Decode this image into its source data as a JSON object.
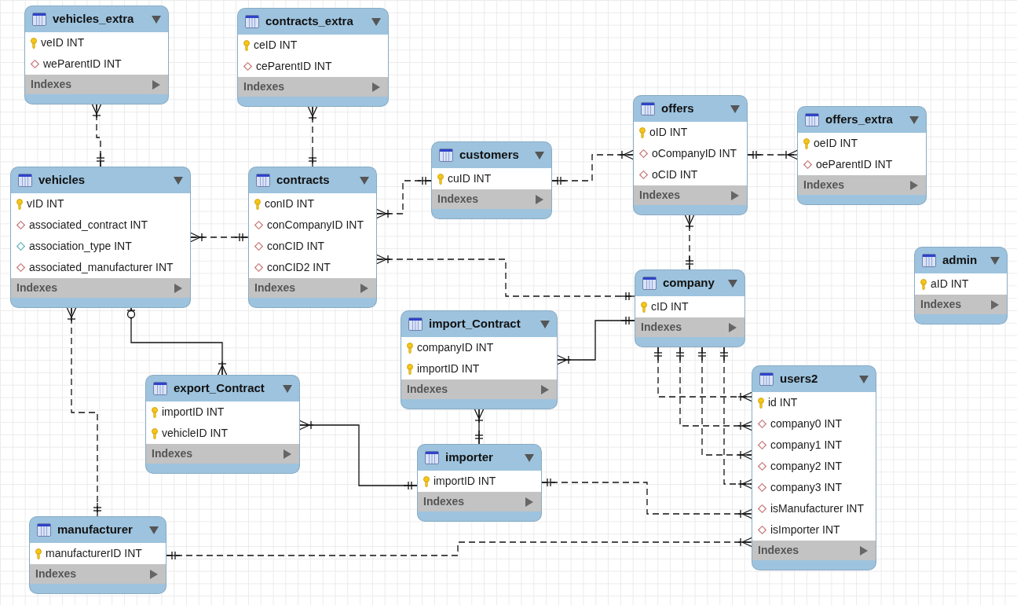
{
  "tables": [
    {
      "name": "vehicles_extra",
      "fields": [
        {
          "label": "veID INT",
          "kind": "primary_key"
        },
        {
          "label": "weParentID INT",
          "kind": "foreign_key"
        }
      ],
      "indexes": "Indexes"
    },
    {
      "name": "contracts_extra",
      "fields": [
        {
          "label": "ceID INT",
          "kind": "primary_key"
        },
        {
          "label": "ceParentID INT",
          "kind": "foreign_key"
        }
      ],
      "indexes": "Indexes"
    },
    {
      "name": "offers",
      "fields": [
        {
          "label": "oID INT",
          "kind": "primary_key"
        },
        {
          "label": "oCompanyID INT",
          "kind": "foreign_key"
        },
        {
          "label": "oCID INT",
          "kind": "foreign_key"
        }
      ],
      "indexes": "Indexes"
    },
    {
      "name": "offers_extra",
      "fields": [
        {
          "label": "oeID INT",
          "kind": "primary_key"
        },
        {
          "label": "oeParentID INT",
          "kind": "foreign_key"
        }
      ],
      "indexes": "Indexes"
    },
    {
      "name": "customers",
      "fields": [
        {
          "label": "cuID INT",
          "kind": "primary_key"
        }
      ],
      "indexes": "Indexes"
    },
    {
      "name": "vehicles",
      "fields": [
        {
          "label": "vID INT",
          "kind": "primary_key"
        },
        {
          "label": "associated_contract INT",
          "kind": "foreign_key"
        },
        {
          "label": "association_type INT",
          "kind": "column"
        },
        {
          "label": "associated_manufacturer INT",
          "kind": "foreign_key"
        }
      ],
      "indexes": "Indexes"
    },
    {
      "name": "contracts",
      "fields": [
        {
          "label": "conID INT",
          "kind": "primary_key"
        },
        {
          "label": "conCompanyID INT",
          "kind": "foreign_key"
        },
        {
          "label": "conCID INT",
          "kind": "foreign_key"
        },
        {
          "label": "conCID2 INT",
          "kind": "foreign_key"
        }
      ],
      "indexes": "Indexes"
    },
    {
      "name": "admin",
      "fields": [
        {
          "label": "aID INT",
          "kind": "primary_key"
        }
      ],
      "indexes": "Indexes"
    },
    {
      "name": "company",
      "fields": [
        {
          "label": "cID INT",
          "kind": "primary_key"
        }
      ],
      "indexes": "Indexes"
    },
    {
      "name": "import_Contract",
      "fields": [
        {
          "label": "companyID INT",
          "kind": "primary_key"
        },
        {
          "label": "importID INT",
          "kind": "primary_key"
        }
      ],
      "indexes": "Indexes"
    },
    {
      "name": "users2",
      "fields": [
        {
          "label": "id INT",
          "kind": "primary_key"
        },
        {
          "label": "company0 INT",
          "kind": "foreign_key"
        },
        {
          "label": "company1 INT",
          "kind": "foreign_key"
        },
        {
          "label": "company2 INT",
          "kind": "foreign_key"
        },
        {
          "label": "company3 INT",
          "kind": "foreign_key"
        },
        {
          "label": "isManufacturer INT",
          "kind": "foreign_key"
        },
        {
          "label": "isImporter INT",
          "kind": "foreign_key"
        }
      ],
      "indexes": "Indexes"
    },
    {
      "name": "export_Contract",
      "fields": [
        {
          "label": "importID INT",
          "kind": "primary_key"
        },
        {
          "label": "vehicleID INT",
          "kind": "primary_key"
        }
      ],
      "indexes": "Indexes"
    },
    {
      "name": "importer",
      "fields": [
        {
          "label": "importID INT",
          "kind": "primary_key"
        }
      ],
      "indexes": "Indexes"
    },
    {
      "name": "manufacturer",
      "fields": [
        {
          "label": "manufacturerID INT",
          "kind": "primary_key"
        }
      ],
      "indexes": "Indexes"
    }
  ],
  "relationships": [
    {
      "identifying": false,
      "start": {
        "many": true,
        "optional": false
      },
      "end": {
        "many": false,
        "optional": false
      }
    },
    {
      "identifying": false,
      "start": {
        "many": true,
        "optional": false
      },
      "end": {
        "many": false,
        "optional": false
      }
    },
    {
      "identifying": false,
      "start": {
        "many": true,
        "optional": false
      },
      "end": {
        "many": false,
        "optional": false
      }
    },
    {
      "identifying": false,
      "start": {
        "many": true,
        "optional": false
      },
      "end": {
        "many": false,
        "optional": false
      }
    },
    {
      "identifying": false,
      "start": {
        "many": false,
        "optional": false
      },
      "end": {
        "many": true,
        "optional": false
      }
    },
    {
      "identifying": false,
      "start": {
        "many": false,
        "optional": false
      },
      "end": {
        "many": true,
        "optional": false
      }
    },
    {
      "identifying": false,
      "start": {
        "many": true,
        "optional": false
      },
      "end": {
        "many": false,
        "optional": false
      }
    },
    {
      "identifying": false,
      "start": {
        "many": true,
        "optional": false
      },
      "end": {
        "many": false,
        "optional": false
      }
    },
    {
      "identifying": true,
      "start": {
        "many": true,
        "optional": false
      },
      "end": {
        "many": false,
        "optional": false
      }
    },
    {
      "identifying": true,
      "start": {
        "many": true,
        "optional": false
      },
      "end": {
        "many": false,
        "optional": false
      }
    },
    {
      "identifying": true,
      "start": {
        "many": false,
        "optional": true
      },
      "end": {
        "many": true,
        "optional": false
      }
    },
    {
      "identifying": true,
      "start": {
        "many": true,
        "optional": false
      },
      "end": {
        "many": false,
        "optional": false
      }
    },
    {
      "identifying": false,
      "start": {
        "many": true,
        "optional": false
      },
      "end": {
        "many": false,
        "optional": false
      }
    },
    {
      "identifying": false,
      "start": {
        "many": false,
        "optional": false
      },
      "end": {
        "many": true,
        "optional": false
      }
    },
    {
      "identifying": false,
      "start": {
        "many": false,
        "optional": false
      },
      "end": {
        "many": true,
        "optional": false
      }
    },
    {
      "identifying": false,
      "start": {
        "many": false,
        "optional": false
      },
      "end": {
        "many": true,
        "optional": false
      }
    },
    {
      "identifying": false,
      "start": {
        "many": false,
        "optional": false
      },
      "end": {
        "many": true,
        "optional": false
      }
    },
    {
      "identifying": false,
      "start": {
        "many": false,
        "optional": false
      },
      "end": {
        "many": true,
        "optional": false
      }
    },
    {
      "identifying": false,
      "start": {
        "many": false,
        "optional": false
      },
      "end": {
        "many": true,
        "optional": false
      }
    }
  ]
}
